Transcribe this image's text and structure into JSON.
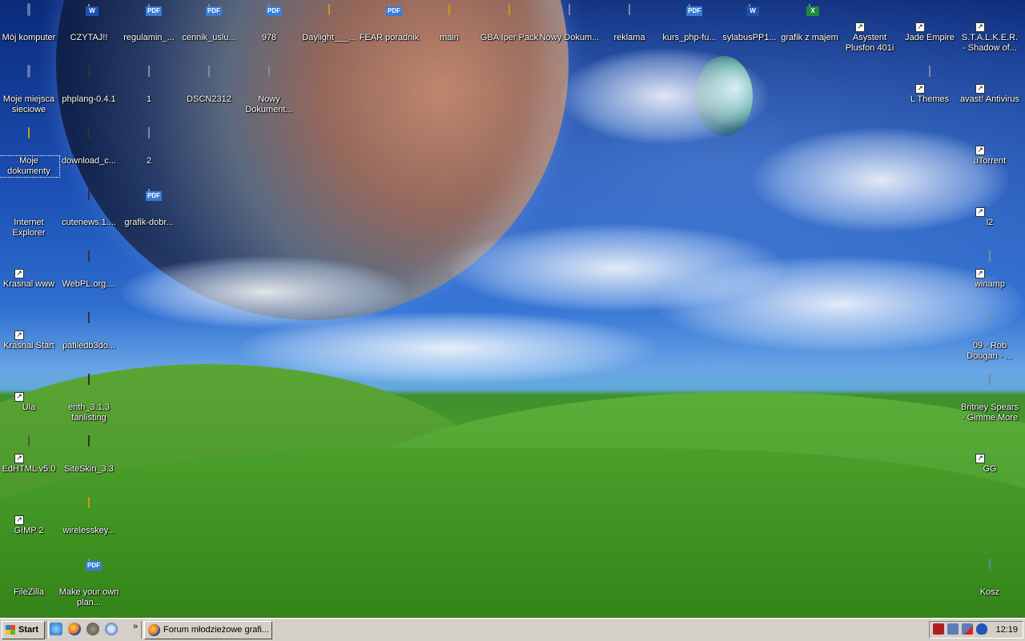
{
  "desktop": {
    "icons": [
      {
        "label": "Mój komputer",
        "kind": "computer",
        "shortcut": false,
        "selected": false
      },
      {
        "label": "CZYTAJ!!",
        "kind": "word",
        "shortcut": false,
        "selected": false
      },
      {
        "label": "regulamin_...",
        "kind": "pdf",
        "shortcut": false,
        "selected": false
      },
      {
        "label": "cennik_uslu...",
        "kind": "pdf",
        "shortcut": false,
        "selected": false
      },
      {
        "label": "978",
        "kind": "pdf",
        "shortcut": false,
        "selected": false
      },
      {
        "label": "Daylight___...",
        "kind": "folder",
        "shortcut": false,
        "selected": false
      },
      {
        "label": "FEAR poradnik",
        "kind": "pdf",
        "shortcut": false,
        "selected": false
      },
      {
        "label": "main",
        "kind": "folder",
        "shortcut": false,
        "selected": false
      },
      {
        "label": "GBA Iper Pack",
        "kind": "folder",
        "shortcut": false,
        "selected": false
      },
      {
        "label": "Nowy Dokum...",
        "kind": "text",
        "shortcut": false,
        "selected": false
      },
      {
        "label": "reklama",
        "kind": "text",
        "shortcut": false,
        "selected": false
      },
      {
        "label": "kurs_php-fu...",
        "kind": "pdf",
        "shortcut": false,
        "selected": false
      },
      {
        "label": "sylabusPP1...",
        "kind": "word",
        "shortcut": false,
        "selected": false
      },
      {
        "label": "grafik z majem",
        "kind": "excel",
        "shortcut": false,
        "selected": false
      },
      {
        "label": "Asystent Plusfon 401i",
        "kind": "app-blue",
        "shortcut": true,
        "selected": false
      },
      {
        "label": "Jade Empire",
        "kind": "app-je",
        "shortcut": true,
        "selected": false
      },
      {
        "label": "S.T.A.L.K.E.R. - Shadow of...",
        "kind": "app-radiation",
        "shortcut": true,
        "selected": false
      },
      {
        "label": "Moje miejsca sieciowe",
        "kind": "network",
        "shortcut": false,
        "selected": false
      },
      {
        "label": "phplang-0.4.1",
        "kind": "rar",
        "shortcut": false,
        "selected": false
      },
      {
        "label": "1",
        "kind": "image",
        "shortcut": false,
        "selected": false
      },
      {
        "label": "DSCN2312",
        "kind": "image",
        "shortcut": false,
        "selected": false
      },
      {
        "label": "Nowy Dokument...",
        "kind": "text",
        "shortcut": false,
        "selected": false
      },
      {
        "label": "L Themes",
        "kind": "media",
        "shortcut": true,
        "selected": false
      },
      {
        "label": "avast! Antivirus",
        "kind": "app-avast",
        "shortcut": true,
        "selected": false
      },
      {
        "label": "Moje dokumenty",
        "kind": "mydocs",
        "shortcut": false,
        "selected": true
      },
      {
        "label": "download_c...",
        "kind": "rar",
        "shortcut": false,
        "selected": false
      },
      {
        "label": "2",
        "kind": "image",
        "shortcut": false,
        "selected": false
      },
      {
        "label": "uTorrent",
        "kind": "app-utorrent",
        "shortcut": true,
        "selected": false
      },
      {
        "label": "Internet Explorer",
        "kind": "app-ie",
        "shortcut": false,
        "selected": false
      },
      {
        "label": "cutenews.1....",
        "kind": "rar",
        "shortcut": false,
        "selected": false
      },
      {
        "label": "grafik-dobr...",
        "kind": "pdf",
        "shortcut": false,
        "selected": false
      },
      {
        "label": "l2",
        "kind": "app-l2",
        "shortcut": true,
        "selected": false
      },
      {
        "label": "Krasnal www",
        "kind": "app-red",
        "shortcut": true,
        "selected": false
      },
      {
        "label": "WebPL.org....",
        "kind": "rar",
        "shortcut": false,
        "selected": false
      },
      {
        "label": "winamp",
        "kind": "media",
        "shortcut": true,
        "selected": false
      },
      {
        "label": "Krasnal Start",
        "kind": "app-dog",
        "shortcut": true,
        "selected": false
      },
      {
        "label": "pafiledb3do...",
        "kind": "rar",
        "shortcut": false,
        "selected": false
      },
      {
        "label": "09 - Rob Dougan - ...",
        "kind": "media",
        "shortcut": false,
        "selected": false
      },
      {
        "label": "Ula",
        "kind": "app-gear",
        "shortcut": true,
        "selected": false
      },
      {
        "label": "enth_3.1.3 fanlisting",
        "kind": "rar",
        "shortcut": false,
        "selected": false
      },
      {
        "label": "Britney Spears - Gimme More",
        "kind": "media",
        "shortcut": false,
        "selected": false
      },
      {
        "label": "EdHTML v5.0",
        "kind": "app-ed",
        "shortcut": true,
        "selected": false
      },
      {
        "label": "SiteSkin_3.3",
        "kind": "rar",
        "shortcut": false,
        "selected": false
      },
      {
        "label": "GG",
        "kind": "app-gg",
        "shortcut": true,
        "selected": false
      },
      {
        "label": "GIMP 2",
        "kind": "app-gimp",
        "shortcut": true,
        "selected": false
      },
      {
        "label": "wirelesskey...",
        "kind": "folder",
        "shortcut": false,
        "selected": false
      },
      {
        "label": "FileZilla",
        "kind": "app-fz",
        "shortcut": false,
        "selected": false
      },
      {
        "label": "Make your own plan...",
        "kind": "pdf",
        "shortcut": false,
        "selected": false
      },
      {
        "label": "Kosz",
        "kind": "recycle",
        "shortcut": false,
        "selected": false
      }
    ]
  },
  "taskbar": {
    "start_label": "Start",
    "quick_launch": [
      "ie-icon",
      "firefox-icon",
      "gimp-icon",
      "gear-icon"
    ],
    "more_chevron": "»",
    "windows": [
      {
        "label": "Forum młodzieżowe grafi...",
        "icon": "firefox-icon"
      }
    ],
    "tray_icons": [
      "settings-icon",
      "network-icon",
      "network-disconnected-icon",
      "antivirus-shield-icon"
    ],
    "clock": "12:19"
  }
}
